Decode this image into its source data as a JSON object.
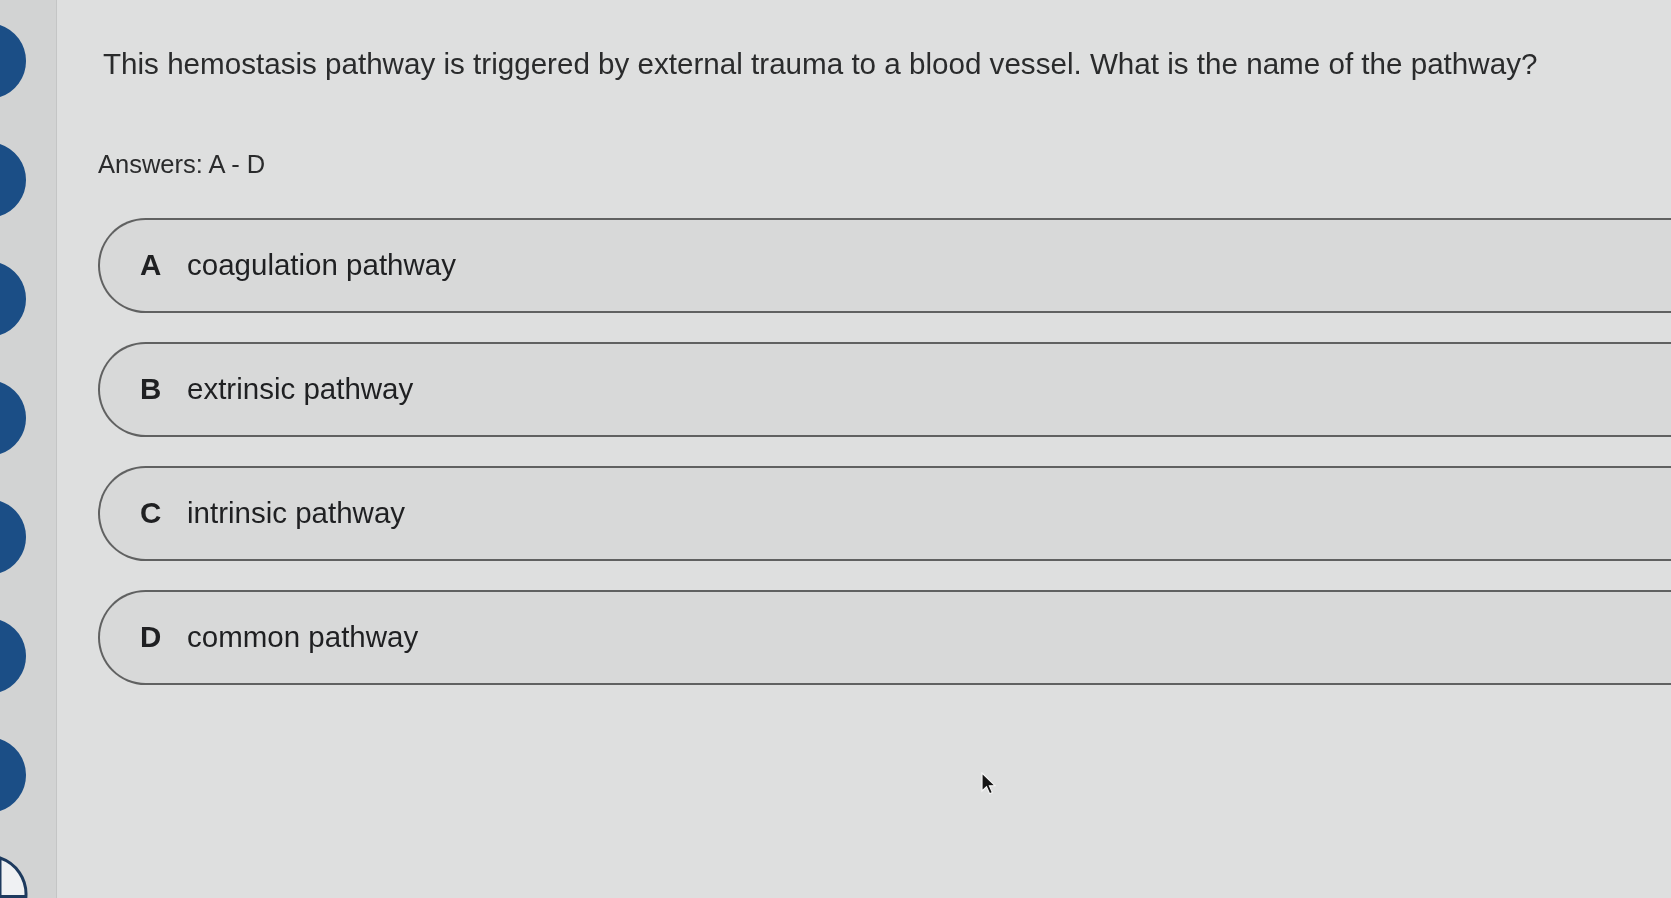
{
  "question": {
    "text": "This hemostasis pathway is triggered by external trauma to a blood vessel. What is the name of the pathway?",
    "answers_label": "Answers: A - D"
  },
  "options": [
    {
      "letter": "A",
      "text": "coagulation pathway",
      "selected": false
    },
    {
      "letter": "B",
      "text": "extrinsic pathway",
      "selected": false
    },
    {
      "letter": "C",
      "text": "intrinsic pathway",
      "selected": false
    },
    {
      "letter": "D",
      "text": "common pathway",
      "selected": false
    }
  ],
  "question_dots": [
    {
      "filled": true
    },
    {
      "filled": true
    },
    {
      "filled": true
    },
    {
      "filled": true
    },
    {
      "filled": true
    },
    {
      "filled": true
    },
    {
      "filled": true
    },
    {
      "filled": false
    }
  ]
}
